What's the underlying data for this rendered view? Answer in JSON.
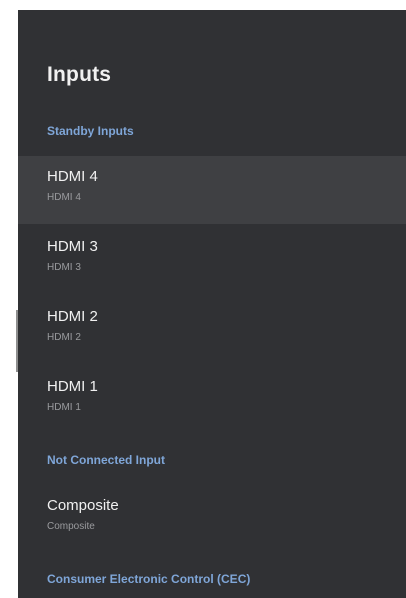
{
  "page": {
    "title": "Inputs"
  },
  "sections": {
    "standby": {
      "header": "Standby Inputs",
      "items": [
        {
          "title": "HDMI 4",
          "subtitle": "HDMI 4",
          "focused": true
        },
        {
          "title": "HDMI 3",
          "subtitle": "HDMI 3"
        },
        {
          "title": "HDMI 2",
          "subtitle": "HDMI 2"
        },
        {
          "title": "HDMI 1",
          "subtitle": "HDMI 1"
        }
      ]
    },
    "not_connected": {
      "header": "Not Connected Input",
      "items": [
        {
          "title": "Composite",
          "subtitle": "Composite"
        }
      ]
    },
    "cec": {
      "header": "Consumer Electronic Control (CEC)"
    }
  },
  "colors": {
    "panel_background": "#303134",
    "focused_row": "#3f4043",
    "section_header": "#7fa6d8",
    "primary_text": "#f1f1f1",
    "secondary_text": "#9a9b9e"
  }
}
